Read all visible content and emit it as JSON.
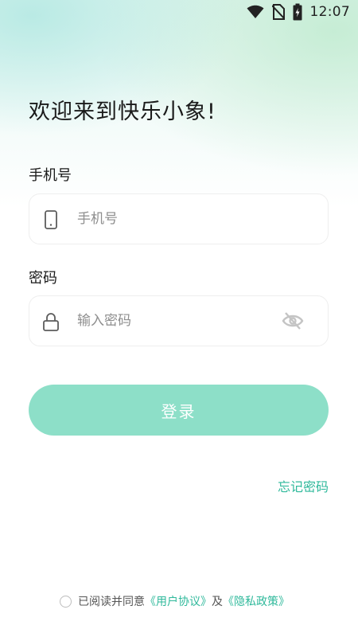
{
  "status_bar": {
    "time": "12:07",
    "icons": [
      "wifi-icon",
      "no-sim-icon",
      "battery-charging-icon"
    ]
  },
  "title": "欢迎来到快乐小象!",
  "phone": {
    "label": "手机号",
    "placeholder": "手机号",
    "value": "",
    "icon": "phone-icon"
  },
  "password": {
    "label": "密码",
    "placeholder": "输入密码",
    "value": "",
    "icon": "lock-icon",
    "toggle_icon": "eye-off-icon"
  },
  "login_button": {
    "label": "登录",
    "color": "#8ddfc8"
  },
  "forgot_password": "忘记密码",
  "agreement": {
    "checked": false,
    "prefix": "已阅读并同意",
    "user_agreement": "《用户协议》",
    "conjunction": "及",
    "privacy_policy": "《隐私政策》"
  },
  "colors": {
    "accent": "#2fb99b",
    "button": "#8ddfc8"
  }
}
